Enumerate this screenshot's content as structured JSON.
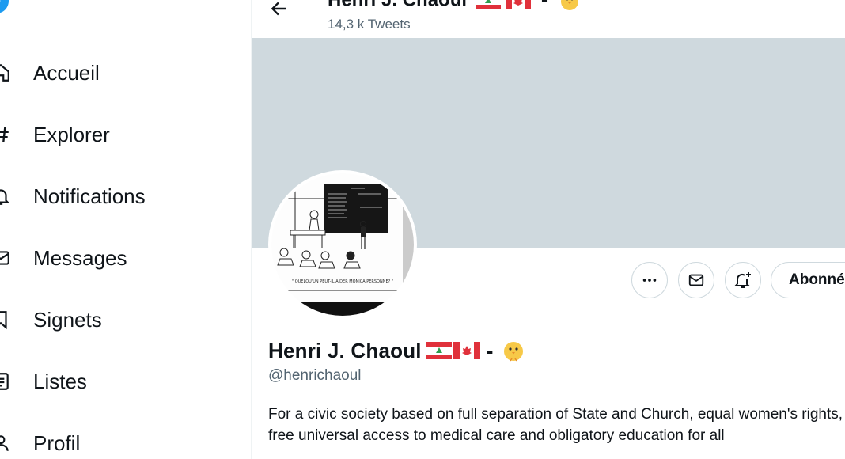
{
  "sidebar": {
    "logo_icon": "twitter-bird-icon",
    "items": [
      {
        "label": "Accueil",
        "icon": "home-icon"
      },
      {
        "label": "Explorer",
        "icon": "hashtag-icon"
      },
      {
        "label": "Notifications",
        "icon": "bell-icon"
      },
      {
        "label": "Messages",
        "icon": "envelope-icon"
      },
      {
        "label": "Signets",
        "icon": "bookmark-icon"
      },
      {
        "label": "Listes",
        "icon": "list-icon"
      },
      {
        "label": "Profil",
        "icon": "person-icon"
      }
    ]
  },
  "header": {
    "back_icon": "arrow-left-icon",
    "title": "Henri J. Chaoul",
    "title_suffix": "-",
    "tweet_count": "14,3 k Tweets"
  },
  "profile": {
    "display_name": "Henri J. Chaoul",
    "name_suffix": "-",
    "handle": "@henrichaoul",
    "bio": "For a civic society based on full separation of State and Church, equal women's rights, free universal access to medical care and obligatory education for all",
    "avatar_caption": "\" QUELQU'UN PEUT-IL AIDER MONICA PERSONNE? \"",
    "emoji": [
      "lebanon-flag",
      "canada-flag",
      "chick-icon"
    ]
  },
  "actions": {
    "more_icon": "more-dots-icon",
    "message_icon": "envelope-icon",
    "notify_icon": "bell-plus-icon",
    "follow_label": "Abonné"
  },
  "colors": {
    "banner": "#cfd9de",
    "twitter_blue": "#1d9bf0",
    "text_primary": "#0f1419",
    "text_secondary": "#536471",
    "border": "#cfd9de"
  }
}
